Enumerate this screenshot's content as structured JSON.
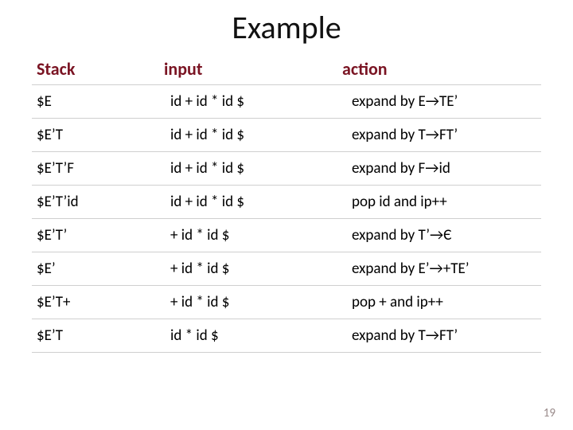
{
  "title": "Example",
  "headers": {
    "stack": "Stack",
    "input": "input",
    "action": "action"
  },
  "rows": [
    {
      "stack": "$E",
      "input": "id + id * id $",
      "action": "expand by E→TE’"
    },
    {
      "stack": "$E’T",
      "input": "id + id * id $",
      "action": "expand by T→FT’"
    },
    {
      "stack": "$E’T’F",
      "input": "id + id * id $",
      "action": "expand by F→id"
    },
    {
      "stack": "$E’T’id",
      "input": "id + id * id $",
      "action": "pop id and ip++"
    },
    {
      "stack": "$E’T’",
      "input": "+ id * id $",
      "action": "expand by T’→Є"
    },
    {
      "stack": "$E’",
      "input": "+ id * id $",
      "action": "expand by E’→+TE’"
    },
    {
      "stack": "$E’T+",
      "input": "+ id * id $",
      "action": "pop + and ip++"
    },
    {
      "stack": "$E’T",
      "input": "id * id $",
      "action": "expand by T→FT’"
    }
  ],
  "page_number": "19"
}
